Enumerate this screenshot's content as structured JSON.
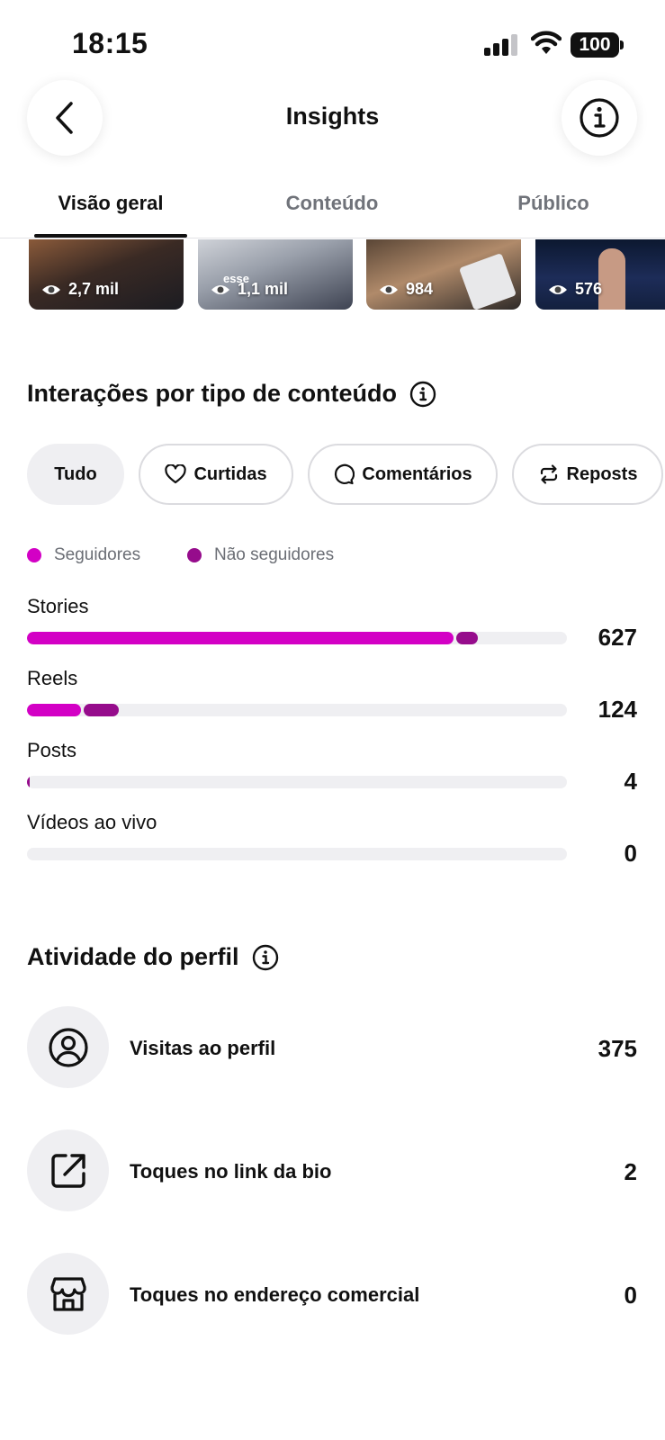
{
  "status_bar": {
    "time": "18:15",
    "battery": "100"
  },
  "header": {
    "title": "Insights"
  },
  "tabs": [
    {
      "label": "Visão geral",
      "active": true
    },
    {
      "label": "Conteúdo",
      "active": false
    },
    {
      "label": "Público",
      "active": false
    }
  ],
  "thumbnails": [
    {
      "views": "2,7 mil",
      "overlay_text": ""
    },
    {
      "views": "1,1 mil",
      "overlay_text": "esse"
    },
    {
      "views": "984",
      "overlay_text": ""
    },
    {
      "views": "576",
      "overlay_text": ""
    }
  ],
  "interactions": {
    "title": "Interações por tipo de conteúdo",
    "filters": [
      {
        "label": "Tudo",
        "icon": "",
        "selected": true
      },
      {
        "label": "Curtidas",
        "icon": "heart-icon",
        "selected": false
      },
      {
        "label": "Comentários",
        "icon": "comment-icon",
        "selected": false
      },
      {
        "label": "Reposts",
        "icon": "repost-icon",
        "selected": false
      }
    ],
    "legend": [
      {
        "label": "Seguidores",
        "color": "#D300C5"
      },
      {
        "label": "Não seguidores",
        "color": "#960C8C"
      }
    ],
    "rows": [
      {
        "label": "Stories",
        "value": "627",
        "followers_fraction": 0.79,
        "non_followers_fraction": 0.04
      },
      {
        "label": "Reels",
        "value": "124",
        "followers_fraction": 0.1,
        "non_followers_fraction": 0.065
      },
      {
        "label": "Posts",
        "value": "4",
        "followers_fraction": 0.0,
        "non_followers_fraction": 0.005
      },
      {
        "label": "Vídeos ao vivo",
        "value": "0",
        "followers_fraction": 0.0,
        "non_followers_fraction": 0.0
      }
    ]
  },
  "activity": {
    "title": "Atividade do perfil",
    "rows": [
      {
        "label": "Visitas ao perfil",
        "value": "375",
        "icon": "profile-icon"
      },
      {
        "label": "Toques no link da bio",
        "value": "2",
        "icon": "external-link-icon"
      },
      {
        "label": "Toques no endereço comercial",
        "value": "0",
        "icon": "storefront-icon"
      }
    ]
  }
}
